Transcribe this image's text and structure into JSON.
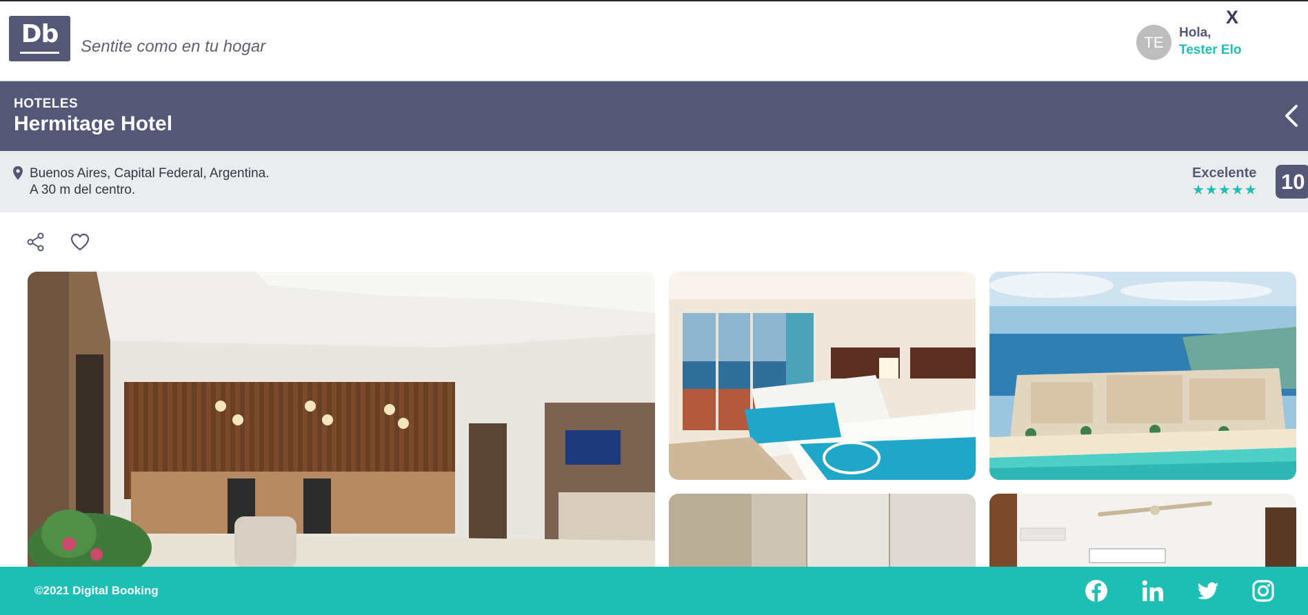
{
  "header": {
    "logo_text": "Db",
    "tagline": "Sentite como en tu hogar",
    "close_label": "X",
    "user": {
      "initials": "TE",
      "greeting": "Hola,",
      "name": "Tester Elo"
    }
  },
  "hotel": {
    "category": "HOTELES",
    "name": "Hermitage Hotel"
  },
  "location": {
    "address": "Buenos Aires, Capital Federal, Argentina.",
    "distance": "A 30 m del centro."
  },
  "rating": {
    "label": "Excelente",
    "stars": "★★★★★",
    "star_count": 5,
    "score": "10"
  },
  "gallery": {
    "photos": [
      "hotel-lobby",
      "hotel-room-ocean-view",
      "beach-aerial",
      "bathroom",
      "room-ceiling-fan"
    ]
  },
  "footer": {
    "copyright": "©2021 Digital Booking",
    "social": [
      "facebook-icon",
      "linkedin-icon",
      "twitter-icon",
      "instagram-icon"
    ]
  },
  "colors": {
    "primary": "#545776",
    "accent": "#1dbeb4",
    "band": "#ebecf0",
    "text": "#31363f"
  }
}
